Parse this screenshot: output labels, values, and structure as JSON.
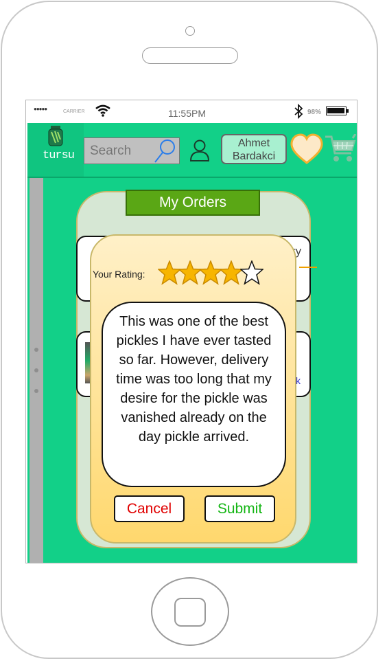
{
  "status_bar": {
    "signal": "●●●●●",
    "carrier": "CARRIER",
    "time": "11:55PM",
    "battery": "98%",
    "battery_level": 0.98
  },
  "header": {
    "logo_text": "tursu",
    "search_placeholder": "Search",
    "user_name_line1": "Ahmet",
    "user_name_line2": "Bardakci"
  },
  "orders": {
    "title": "My Orders",
    "card1_partial_text": "ry",
    "card2_partial_link": "k"
  },
  "rating_popup": {
    "label": "Your Rating:",
    "rating": 4,
    "max_rating": 5,
    "review_text": "This was one of the best pickles I have ever tasted so far. However, delivery time was too long that my desire for the pickle was vanished already on the day pickle arrived.",
    "cancel_label": "Cancel",
    "submit_label": "Submit"
  },
  "colors": {
    "app_background": "#12d088",
    "title_bar": "#5aa715",
    "cancel_text": "#e00000",
    "submit_text": "#13b513",
    "star_fill": "#f7b500"
  }
}
